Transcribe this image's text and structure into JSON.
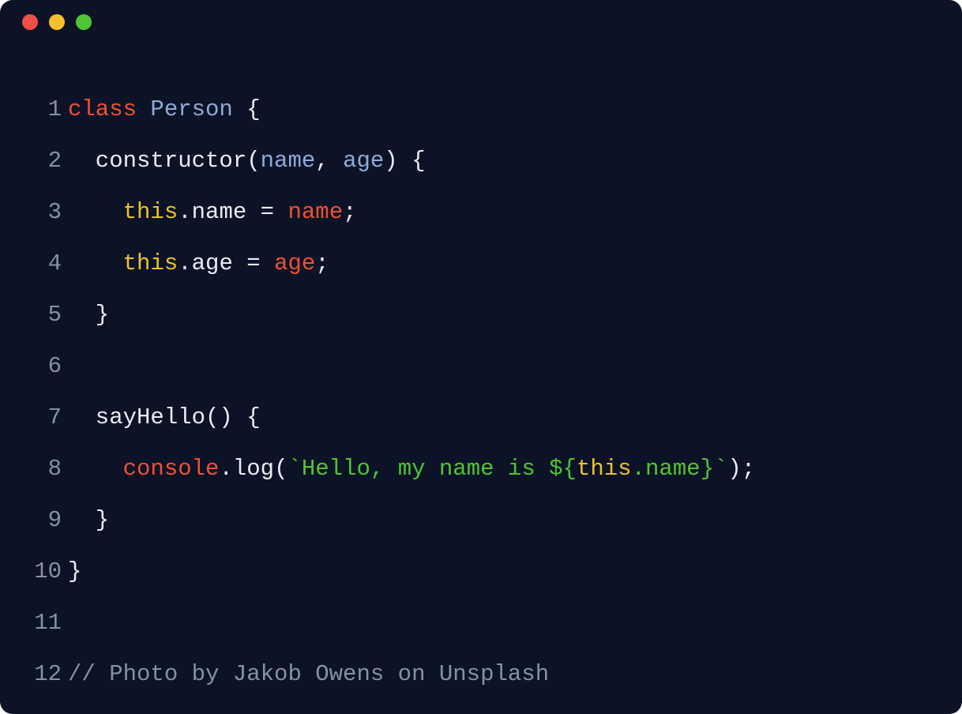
{
  "window": {
    "traffic_lights": [
      "red",
      "yellow",
      "green"
    ]
  },
  "code": {
    "lines": [
      {
        "num": "1",
        "tokens": [
          {
            "cls": "tok-keyword",
            "text": "class "
          },
          {
            "cls": "tok-classname",
            "text": "Person "
          },
          {
            "cls": "tok-plain",
            "text": "{"
          }
        ]
      },
      {
        "num": "2",
        "tokens": [
          {
            "cls": "tok-plain",
            "text": "  constructor("
          },
          {
            "cls": "tok-param",
            "text": "name"
          },
          {
            "cls": "tok-plain",
            "text": ", "
          },
          {
            "cls": "tok-param",
            "text": "age"
          },
          {
            "cls": "tok-plain",
            "text": ") {"
          }
        ]
      },
      {
        "num": "3",
        "tokens": [
          {
            "cls": "tok-plain",
            "text": "    "
          },
          {
            "cls": "tok-this",
            "text": "this"
          },
          {
            "cls": "tok-plain",
            "text": ".name = "
          },
          {
            "cls": "tok-value",
            "text": "name"
          },
          {
            "cls": "tok-plain",
            "text": ";"
          }
        ]
      },
      {
        "num": "4",
        "tokens": [
          {
            "cls": "tok-plain",
            "text": "    "
          },
          {
            "cls": "tok-this",
            "text": "this"
          },
          {
            "cls": "tok-plain",
            "text": ".age = "
          },
          {
            "cls": "tok-value",
            "text": "age"
          },
          {
            "cls": "tok-plain",
            "text": ";"
          }
        ]
      },
      {
        "num": "5",
        "tokens": [
          {
            "cls": "tok-plain",
            "text": "  }"
          }
        ]
      },
      {
        "num": "6",
        "tokens": []
      },
      {
        "num": "7",
        "tokens": [
          {
            "cls": "tok-plain",
            "text": "  sayHello() {"
          }
        ]
      },
      {
        "num": "8",
        "tokens": [
          {
            "cls": "tok-plain",
            "text": "    "
          },
          {
            "cls": "tok-object",
            "text": "console"
          },
          {
            "cls": "tok-plain",
            "text": ".log("
          },
          {
            "cls": "tok-string",
            "text": "`Hello, my name is "
          },
          {
            "cls": "tok-string",
            "text": "${"
          },
          {
            "cls": "tok-interp",
            "text": "this"
          },
          {
            "cls": "tok-string",
            "text": ".name}`"
          },
          {
            "cls": "tok-plain",
            "text": ");"
          }
        ]
      },
      {
        "num": "9",
        "tokens": [
          {
            "cls": "tok-plain",
            "text": "  }"
          }
        ]
      },
      {
        "num": "10",
        "tokens": [
          {
            "cls": "tok-plain",
            "text": "}"
          }
        ]
      },
      {
        "num": "11",
        "tokens": []
      },
      {
        "num": "12",
        "tokens": [
          {
            "cls": "tok-comment",
            "text": "// Photo by Jakob Owens on Unsplash"
          }
        ]
      }
    ]
  }
}
